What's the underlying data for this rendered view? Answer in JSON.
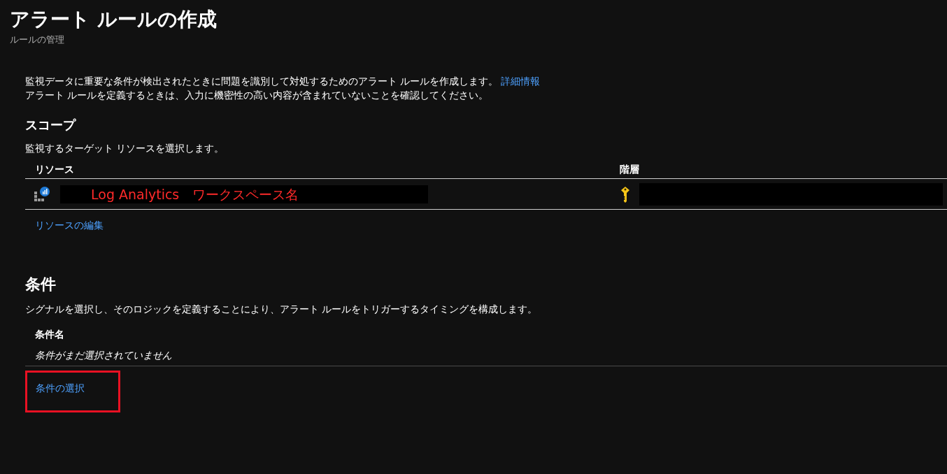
{
  "header": {
    "title": "アラート ルールの作成",
    "subtitle": "ルールの管理"
  },
  "intro": {
    "text": "監視データに重要な条件が検出されたときに問題を識別して対処するためのアラート ルールを作成します。",
    "link": "詳細情報",
    "note": "アラート ルールを定義するときは、入力に機密性の高い内容が含まれていないことを確認してください。"
  },
  "scope": {
    "heading": "スコープ",
    "description": "監視するターゲット リソースを選択します。",
    "table": {
      "columns": [
        "リソース",
        "階層"
      ],
      "rows": [
        {
          "resource": "Log Analytics　ワークスペース名",
          "resource_redacted": true,
          "hierarchy_redacted": true
        }
      ]
    },
    "edit_link": "リソースの編集"
  },
  "conditions": {
    "heading": "条件",
    "description": "シグナルを選択し、そのロジックを定義することにより、アラート ルールをトリガーするタイミングを構成します。",
    "table": {
      "columns": [
        "条件名"
      ],
      "empty_text": "条件がまだ選択されていません"
    },
    "select_link": "条件の選択",
    "select_link_highlighted": true
  }
}
